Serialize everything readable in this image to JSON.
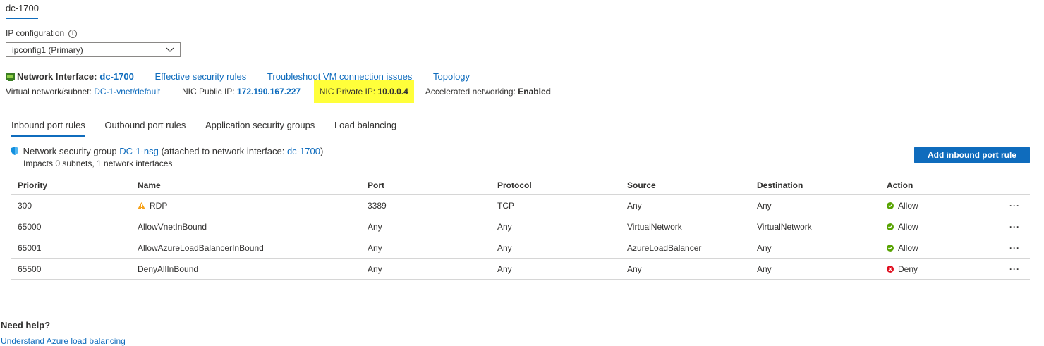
{
  "top_tab": "dc-1700",
  "ip_config": {
    "label": "IP configuration",
    "selected": "ipconfig1 (Primary)"
  },
  "nic": {
    "title": "Network Interface:",
    "name": "dc-1700",
    "links": [
      "Effective security rules",
      "Troubleshoot VM connection issues",
      "Topology"
    ]
  },
  "details": {
    "vnet_label": "Virtual network/subnet:",
    "vnet_value": "DC-1-vnet/default",
    "public_ip_label": "NIC Public IP:",
    "public_ip_value": "172.190.167.227",
    "private_ip_label": "NIC Private IP:",
    "private_ip_value": "10.0.0.4",
    "accel_label": "Accelerated networking:",
    "accel_value": "Enabled"
  },
  "tabs": [
    "Inbound port rules",
    "Outbound port rules",
    "Application security groups",
    "Load balancing"
  ],
  "nsg": {
    "prefix": "Network security group",
    "name": "DC-1-nsg",
    "middle": "(attached to network interface:",
    "nic": "dc-1700",
    "suffix": ")",
    "impacts": "Impacts 0 subnets, 1 network interfaces"
  },
  "add_button": "Add inbound port rule",
  "table": {
    "headers": [
      "Priority",
      "Name",
      "Port",
      "Protocol",
      "Source",
      "Destination",
      "Action"
    ],
    "rows": [
      {
        "priority": "300",
        "name": "RDP",
        "warning": true,
        "port": "3389",
        "protocol": "TCP",
        "source": "Any",
        "destination": "Any",
        "action": "Allow"
      },
      {
        "priority": "65000",
        "name": "AllowVnetInBound",
        "warning": false,
        "port": "Any",
        "protocol": "Any",
        "source": "VirtualNetwork",
        "destination": "VirtualNetwork",
        "action": "Allow"
      },
      {
        "priority": "65001",
        "name": "AllowAzureLoadBalancerInBound",
        "warning": false,
        "port": "Any",
        "protocol": "Any",
        "source": "AzureLoadBalancer",
        "destination": "Any",
        "action": "Allow"
      },
      {
        "priority": "65500",
        "name": "DenyAllInBound",
        "warning": false,
        "port": "Any",
        "protocol": "Any",
        "source": "Any",
        "destination": "Any",
        "action": "Deny"
      }
    ],
    "more_label": "···"
  },
  "help": {
    "title": "Need help?",
    "link": "Understand Azure load balancing"
  },
  "colors": {
    "accent": "#0f6cbd",
    "allow": "#57a300",
    "deny": "#e00b1c",
    "warning": "#f7a21a",
    "highlight": "#ffff3a"
  }
}
